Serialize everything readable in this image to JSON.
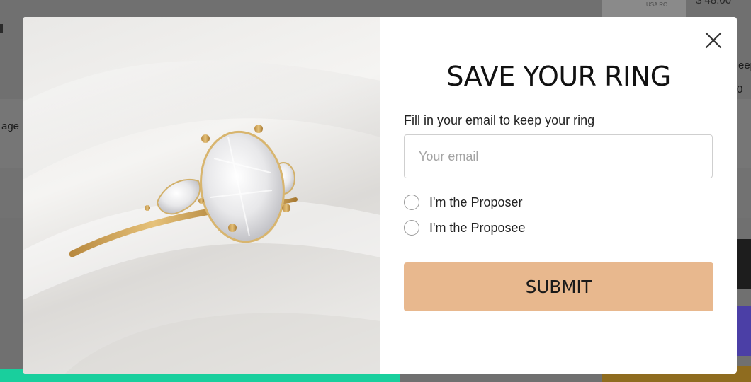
{
  "background_page": {
    "left_fragment": "age",
    "right_fragment_1": "eep",
    "right_fragment_2": "0",
    "thumbnail_label": "USA RO",
    "top_right_fragment": "$ 48.00"
  },
  "modal": {
    "image_alt": "Oval diamond engagement ring with pear side stones on yellow gold band",
    "title": "SAVE YOUR RING",
    "subtitle": "Fill in your email to keep your ring",
    "email_placeholder": "Your email",
    "email_value": "",
    "radio_options": [
      "I'm the Proposer",
      "I'm the Proposee"
    ],
    "submit_label": "SUBMIT",
    "close_icon": "close-icon"
  },
  "colors": {
    "submit_bg": "#e8b88e",
    "overlay": "#707070",
    "teal_bar": "#19cf9d",
    "purple_button": "#4b3fa6",
    "gold_button": "#8f6c1f"
  }
}
